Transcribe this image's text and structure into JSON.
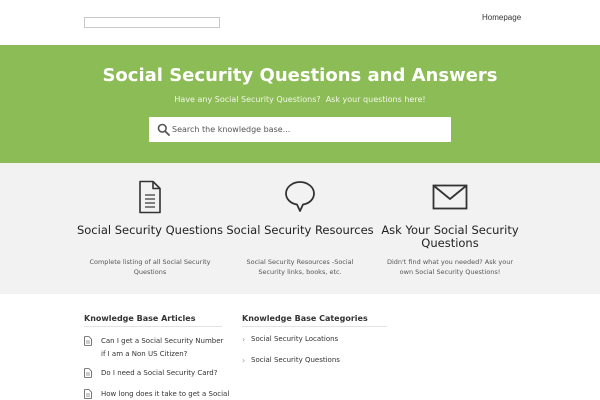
{
  "header": {
    "nav_homepage": "Homepage"
  },
  "hero": {
    "title": "Social Security Questions and Answers",
    "subtitle": "Have any Social Security Questions?  Ask your questions here!",
    "search_placeholder": "Search the knowledge base...",
    "background_color": "#8cbc55"
  },
  "features": [
    {
      "icon": "document-icon",
      "title": "Social Security Questions",
      "description": "Complete listing of all Social Security Questions"
    },
    {
      "icon": "speech-bubble-icon",
      "title": "Social Security Resources",
      "description": "Social Security Resources -Social Security links, books, etc."
    },
    {
      "icon": "envelope-icon",
      "title": "Ask Your Social Security Questions",
      "description": "Didn't find what you needed?  Ask your own Social Security Questions!"
    }
  ],
  "articles": {
    "heading": "Knowledge Base Articles",
    "items": [
      "Can I get a Social Security Number if I am a Non US Citizen?",
      "Do I need a Social Security Card?",
      "How long does it take to get a Social"
    ]
  },
  "categories": {
    "heading": "Knowledge Base Categories",
    "items": [
      "Social Security Locations",
      "Social Security Questions"
    ]
  }
}
